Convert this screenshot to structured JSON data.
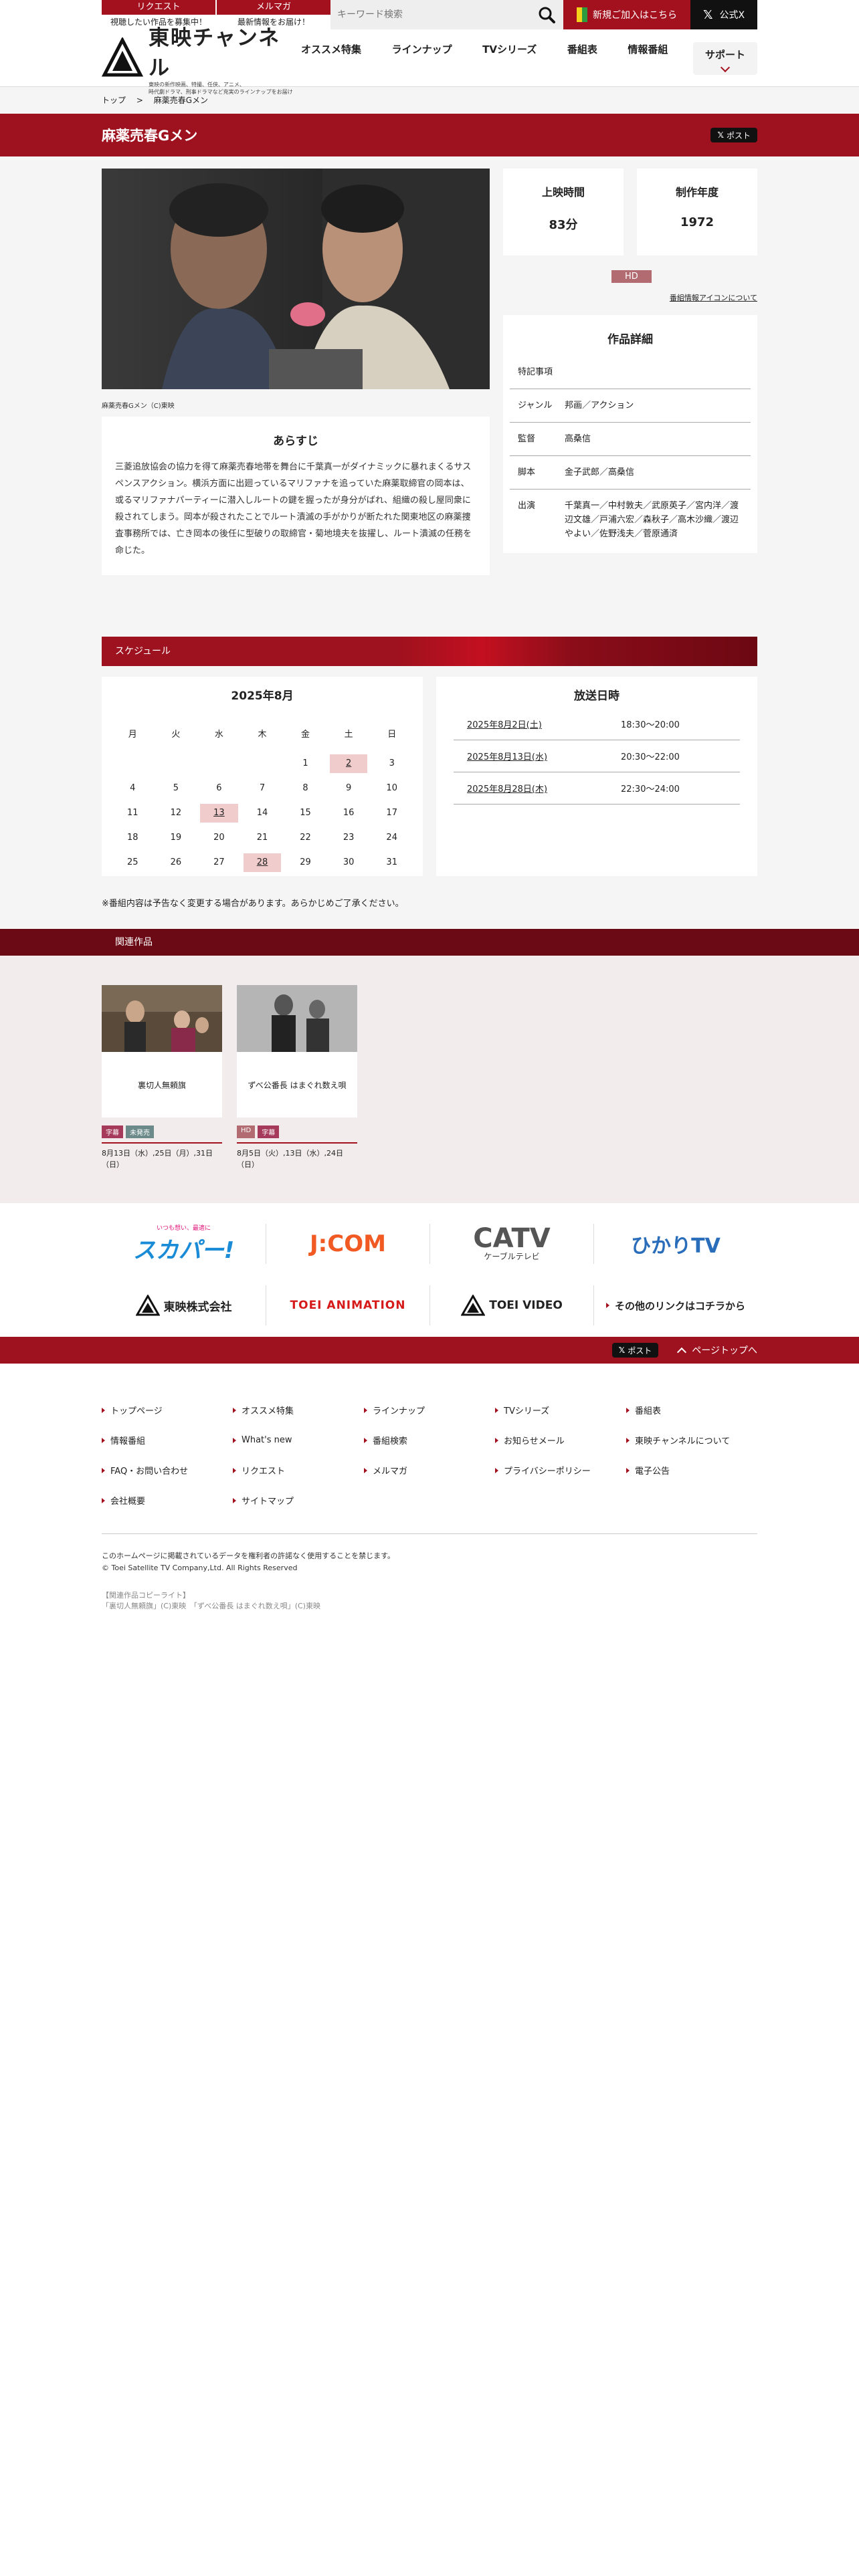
{
  "topbar": {
    "request_tab": "リクエスト",
    "request_sub": "視聴したい作品を募集中！",
    "mailmag_tab": "メルマガ",
    "mailmag_sub": "最新情報をお届け！",
    "search_placeholder": "キーワード検索",
    "join_label": "新規ご加入はこちら",
    "x_label": "公式X"
  },
  "header": {
    "logo_text": "東映チャンネル",
    "logo_tagline_1": "東映の新作映画、特撮、任侠、アニメ、",
    "logo_tagline_2": "時代劇ドラマ、刑事ドラマなど充実のラインナップをお届け",
    "nav": [
      "オススメ特集",
      "ラインナップ",
      "TVシリーズ",
      "番組表",
      "情報番組",
      "サポート"
    ]
  },
  "breadcrumb": {
    "home": "トップ",
    "separator": ">",
    "current": "麻薬売春Gメン"
  },
  "title": {
    "text": "麻薬売春Gメン",
    "post_label": "ポスト"
  },
  "hero": {
    "caption": "麻薬売春Gメン（C)東映"
  },
  "synopsis": {
    "heading": "あらすじ",
    "text": "三菱追放協会の協力を得て麻薬売春地帯を舞台に千葉真一がダイナミックに暴れまくるサスペンスアクション。横浜方面に出廻っているマリファナを追っていた麻薬取締官の岡本は、或るマリファナパーティーに潜入しルートの鍵を握ったが身分がばれ、組織の殺し屋同衆に殺されてしまう。岡本が殺されたことでルート漬滅の手がかりが断たれた関東地区の麻薬捜査事務所では、亡き岡本の後任に型破りの取締官・菊地境夫を抜擢し、ルート潰滅の任務を命じた。"
  },
  "info": {
    "runtime_label": "上映時間",
    "runtime_value": "83分",
    "year_label": "制作年度",
    "year_value": "1972",
    "hd_badge": "HD",
    "icon_link": "番組情報アイコンについて"
  },
  "details": {
    "heading": "作品詳細",
    "rows": [
      {
        "key": "特記事項",
        "value": ""
      },
      {
        "key": "ジャンル",
        "value": "邦画／アクション"
      },
      {
        "key": "監督",
        "value": "高桑信"
      },
      {
        "key": "脚本",
        "value": "金子武郎／高桑信"
      },
      {
        "key": "出演",
        "value": "千葉真一／中村敦夫／武原英子／宮内洋／渡辺文雄／戸浦六宏／森秋子／高木沙織／渡辺やよい／佐野浅夫／菅原通済"
      }
    ]
  },
  "schedule": {
    "bar_label": "スケジュール",
    "month_title": "2025年8月",
    "dow": [
      "月",
      "火",
      "水",
      "木",
      "金",
      "土",
      "日"
    ],
    "lead_blanks": 4,
    "days_in_month": 31,
    "highlight_days": [
      2,
      13,
      28
    ],
    "air_heading": "放送日時",
    "airs": [
      {
        "date": "2025年8月2日(土)",
        "time": "18:30〜20:00"
      },
      {
        "date": "2025年8月13日(水)",
        "time": "20:30〜22:00"
      },
      {
        "date": "2025年8月28日(木)",
        "time": "22:30〜24:00"
      }
    ],
    "notice": "※番組内容は予告なく変更する場合があります。あらかじめご了承ください。"
  },
  "related": {
    "bar_label": "関連作品",
    "items": [
      {
        "title": "裏切人無頼旗",
        "tags": [
          "字幕",
          "未発売"
        ],
        "dates": "8月13日（水）,25日（月）,31日（日）"
      },
      {
        "title": "ずべ公番長 はまぐれ数え唄",
        "tags": [
          "HD",
          "字幕"
        ],
        "dates": "8月5日（火）,13日（水）,24日（日）"
      }
    ]
  },
  "partners": {
    "row1": [
      "スカパー!",
      "J:COM",
      "CATV",
      "ひかりTV"
    ],
    "catv_sub": "ケーブルテレビ",
    "sky_tagline": "いつも想い、最適に",
    "row2": [
      "東映株式会社",
      "TOEI ANIMATION",
      "TOEI VIDEO",
      "その他のリンクはコチラから"
    ]
  },
  "pagetop": {
    "post_label": "ポスト",
    "label": "ページトップへ"
  },
  "footer": {
    "links": [
      "トップページ",
      "オススメ特集",
      "ラインナップ",
      "TVシリーズ",
      "番組表",
      "情報番組",
      "What's new",
      "番組検索",
      "お知らせメール",
      "東映チャンネルについて",
      "FAQ・お問い合わせ",
      "リクエスト",
      "メルマガ",
      "プライバシーポリシー",
      "電子公告",
      "会社概要",
      "サイトマップ"
    ],
    "copy_1": "このホームページに掲載されているデータを権利者の許諾なく使用することを禁じます。",
    "copy_2": "© Toei Satellite TV Company,Ltd. All Rights Reserved",
    "rights_1": "【関連作品コピーライト】",
    "rights_2": "「裏切人無頼旗」(C)東映　「ずべ公番長 はまぐれ数え唄」(C)東映"
  },
  "colors": {
    "brand_red": "#9e111e",
    "highlight_pink": "#f0cccc",
    "dark_red": "#6b0a14"
  }
}
